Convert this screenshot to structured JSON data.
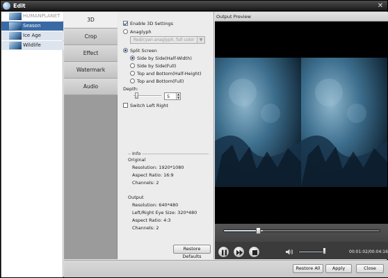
{
  "window": {
    "title": "Edit",
    "close_glyph": "✕",
    "app_icon": "app-logo-icon"
  },
  "file_list": {
    "header": "HUMANPLANET",
    "items": [
      {
        "label": "Season",
        "selected": true
      },
      {
        "label": "Ice Age",
        "selected": false
      },
      {
        "label": "Wildlife",
        "selected": false
      }
    ]
  },
  "tabs": [
    {
      "label": "3D",
      "active": true
    },
    {
      "label": "Crop",
      "active": false
    },
    {
      "label": "Effect",
      "active": false
    },
    {
      "label": "Watermark",
      "active": false
    },
    {
      "label": "Audio",
      "active": false
    }
  ],
  "settings_3d": {
    "enable_label": "Enable 3D Settings",
    "enable_checked": true,
    "anaglyph_label": "Anaglyph",
    "anaglyph_value": "Red/cyan anaglyph, full color",
    "split_label": "Split Screen",
    "split_options": [
      {
        "label": "Side by Side(Half-Width)",
        "selected": true
      },
      {
        "label": "Side by Side(Full)",
        "selected": false
      },
      {
        "label": "Top and Bottom(Half-Height)",
        "selected": false
      },
      {
        "label": "Top and Bottom(Full)",
        "selected": false
      }
    ],
    "depth_label": "Depth:",
    "depth_value": "5",
    "switch_label": "Switch Left Right",
    "switch_checked": false
  },
  "info": {
    "title": "Info",
    "original_label": "Original",
    "original": {
      "resolution": "Resolution: 1920*1080",
      "aspect": "Aspect Ratio: 16:9",
      "channels": "Channels: 2"
    },
    "output_label": "Output",
    "output": {
      "resolution": "Resolution: 640*480",
      "eye_size": "Left/Right Eye Size: 320*480",
      "aspect": "Aspect Ratio: 4:3",
      "channels": "Channels: 2"
    }
  },
  "buttons": {
    "restore_defaults": "Restore Defaults",
    "restore_all": "Restore All",
    "apply": "Apply",
    "close": "Close"
  },
  "preview": {
    "title": "Output Preview",
    "seek_progress": 0.25,
    "volume": 0.9,
    "time": "00:01:02/00:04:16"
  },
  "colors": {
    "selected_row": "#3a6aa3",
    "titlebar": "#2b2b2b",
    "preview_bg": "#000000",
    "video_tint": "#3d6f8e"
  }
}
